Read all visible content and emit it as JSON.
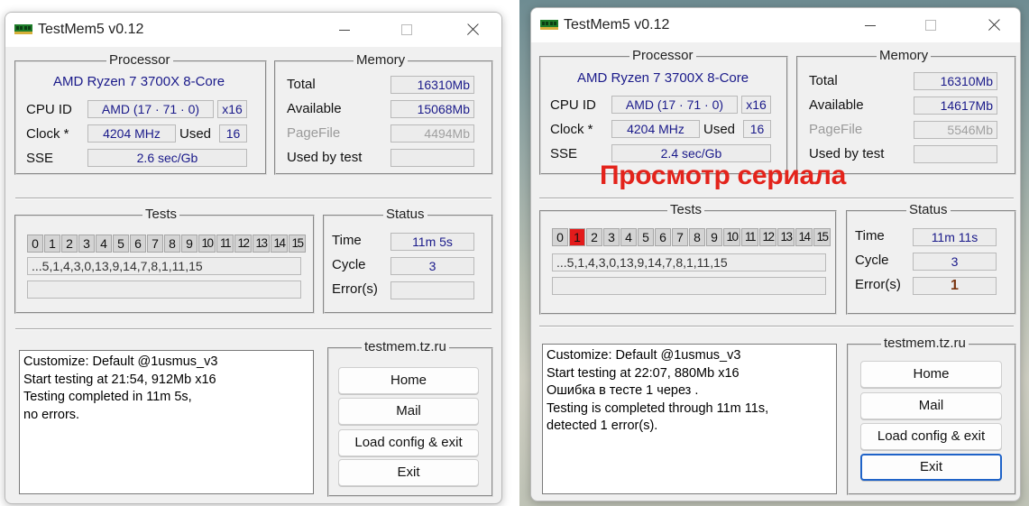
{
  "colors": {
    "value_text": "#1a1a8a",
    "failed_test_cell": "#e31b1b",
    "overlay_text": "#e3231b",
    "focus_border": "#1f63c8"
  },
  "icons": {
    "app": "ram-chip-icon",
    "minimize": "minimize-icon",
    "maximize": "maximize-icon",
    "close": "close-icon"
  },
  "overlay_caption": "Просмотр сериала",
  "windows": [
    {
      "title": "TestMem5 v0.12",
      "processor": {
        "label": "Processor",
        "name": "AMD Ryzen 7 3700X 8-Core",
        "cpu_id_label": "CPU ID",
        "cpu_id_value": "AMD  (17 · 71 · 0)",
        "threads": "x16",
        "clock_label": "Clock *",
        "clock_value": "4204 MHz",
        "used_label": "Used",
        "used_value": "16",
        "sse_label": "SSE",
        "sse_value": "2.6 sec/Gb"
      },
      "memory": {
        "label": "Memory",
        "total_label": "Total",
        "total_value": "16310Mb",
        "available_label": "Available",
        "available_value": "15068Mb",
        "pagefile_label": "PageFile",
        "pagefile_value": "4494Mb",
        "used_by_test_label": "Used by test",
        "used_by_test_value": ""
      },
      "tests": {
        "label": "Tests",
        "cells": [
          "0",
          "1",
          "2",
          "3",
          "4",
          "5",
          "6",
          "7",
          "8",
          "9",
          "10",
          "11",
          "12",
          "13",
          "14",
          "15"
        ],
        "failed_cells": [],
        "sequence": "...5,1,4,3,0,13,9,14,7,8,1,11,15",
        "progress": ""
      },
      "status": {
        "label": "Status",
        "time_label": "Time",
        "time_value": "11m 5s",
        "cycle_label": "Cycle",
        "cycle_value": "3",
        "errors_label": "Error(s)",
        "errors_value": ""
      },
      "log_lines": [
        "Customize: Default @1usmus_v3",
        "Start testing at 21:54, 912Mb x16",
        "Testing completed in 11m 5s,",
        "no errors."
      ],
      "links": {
        "label": "testmem.tz.ru",
        "home": "Home",
        "mail": "Mail",
        "load_config": "Load config & exit",
        "exit": "Exit"
      }
    },
    {
      "title": "TestMem5 v0.12",
      "processor": {
        "label": "Processor",
        "name": "AMD Ryzen 7 3700X 8-Core",
        "cpu_id_label": "CPU ID",
        "cpu_id_value": "AMD  (17 · 71 · 0)",
        "threads": "x16",
        "clock_label": "Clock *",
        "clock_value": "4204 MHz",
        "used_label": "Used",
        "used_value": "16",
        "sse_label": "SSE",
        "sse_value": "2.4 sec/Gb"
      },
      "memory": {
        "label": "Memory",
        "total_label": "Total",
        "total_value": "16310Mb",
        "available_label": "Available",
        "available_value": "14617Mb",
        "pagefile_label": "PageFile",
        "pagefile_value": "5546Mb",
        "used_by_test_label": "Used by test",
        "used_by_test_value": ""
      },
      "tests": {
        "label": "Tests",
        "cells": [
          "0",
          "1",
          "2",
          "3",
          "4",
          "5",
          "6",
          "7",
          "8",
          "9",
          "10",
          "11",
          "12",
          "13",
          "14",
          "15"
        ],
        "failed_cells": [
          "1"
        ],
        "sequence": "...5,1,4,3,0,13,9,14,7,8,1,11,15",
        "progress": ""
      },
      "status": {
        "label": "Status",
        "time_label": "Time",
        "time_value": "11m 11s",
        "cycle_label": "Cycle",
        "cycle_value": "3",
        "errors_label": "Error(s)",
        "errors_value": "1"
      },
      "log_lines": [
        "Customize: Default @1usmus_v3",
        "Start testing at 22:07, 880Mb x16",
        "Ошибка в тесте 1 через .",
        "Testing is completed through 11m 11s,",
        "detected 1 error(s)."
      ],
      "links": {
        "label": "testmem.tz.ru",
        "home": "Home",
        "mail": "Mail",
        "load_config": "Load config & exit",
        "exit": "Exit"
      }
    }
  ]
}
